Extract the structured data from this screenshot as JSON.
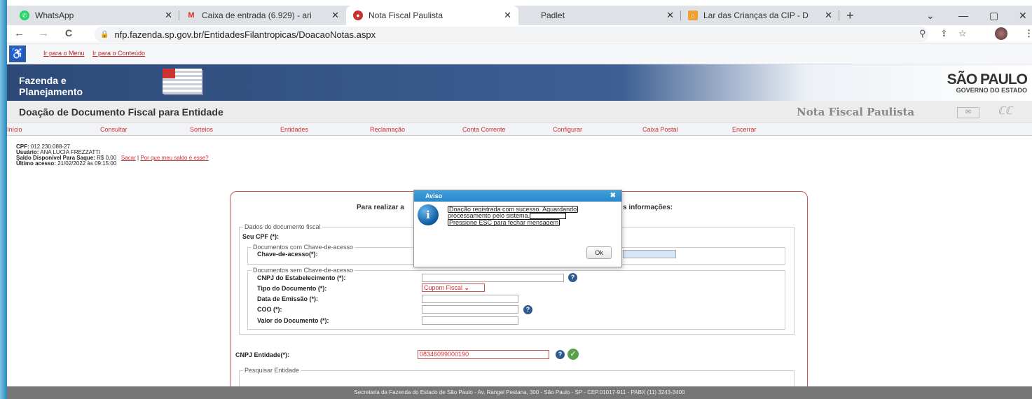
{
  "browser": {
    "tabs": [
      {
        "title": "WhatsApp",
        "active": false
      },
      {
        "title": "Caixa de entrada (6.929) - ari",
        "active": false
      },
      {
        "title": "Nota Fiscal Paulista",
        "active": true
      },
      {
        "title": "Padlet",
        "active": false
      },
      {
        "title": "Lar das Crianças da CIP - Do",
        "active": false
      }
    ],
    "url": "nfp.fazenda.sp.gov.br/EntidadesFilantropicas/DoacaoNotas.aspx",
    "nav": {
      "back": "←",
      "forward": "→",
      "reload": "C",
      "new_tab": "+"
    },
    "window": {
      "dropdown": "⌄",
      "minimize": "—",
      "maximize": "▢",
      "close": "✕"
    }
  },
  "accessibility": {
    "menu_link": "Ir para o Menu",
    "content_link": "Ir para o Conteúdo"
  },
  "banner": {
    "org_line1": "Fazenda e",
    "org_line2": "Planejamento",
    "state_logo_line1": "SÃO PAULO",
    "state_logo_line2": "GOVERNO DO ESTADO"
  },
  "title_bar": {
    "page_title": "Doação de Documento Fiscal para Entidade",
    "brand": "Nota Fiscal Paulista"
  },
  "menu": [
    "Início",
    "Consultar",
    "Sorteios",
    "Entidades",
    "Reclamação",
    "Conta Corrente",
    "Configurar",
    "Caixa Postal",
    "Encerrar"
  ],
  "user": {
    "cpf_label": "CPF:",
    "cpf": "012.230.088-27",
    "user_label": "Usuário:",
    "name": "ANA LUCIA FREZZATTI",
    "balance_label": "Saldo Disponível Para Saque:",
    "balance": "R$ 0,00",
    "withdraw_link": "Sacar",
    "separator": "|",
    "why_link": "Por que meu saldo é esse?",
    "last_access_label": "Último acesso:",
    "last_access": "21/02/2022 às 09:15:00"
  },
  "form": {
    "intro": "Para realizar a",
    "intro_tail": "s informações:",
    "doc_legend": "Dados do documento fiscal",
    "cpf_label": "Seu CPF (*):",
    "key_legend": "Documentos com Chave-de-acesso",
    "key_label": "Chave-de-acesso(*):",
    "nokey_legend": "Documentos sem Chave-de-acesso",
    "cnpj_estab_label": "CNPJ do Estabelecimento (*):",
    "doc_type_label": "Tipo do Documento (*):",
    "doc_type_value": "Cupom Fiscal",
    "emission_label": "Data de Emissão (*):",
    "coo_label": "COO (*):",
    "value_label": "Valor do Documento (*):",
    "entity_label": "CNPJ Entidade(*):",
    "entity_value": "08346099000190",
    "search_legend": "Pesquisar Entidade"
  },
  "modal": {
    "title": "Aviso",
    "close": "✖",
    "info_glyph": "i",
    "line1": "Doação registrada com sucesso. Aguardando",
    "line2": "processamento pelo sistema.",
    "line3": "Pressione ESC para fechar mensagem",
    "ok": "Ok"
  },
  "footer": "Secretaria da Fazenda do Estado de São Paulo - Av. Rangel Pestana, 300 - São Paulo - SP - CEP.01017-911 - PABX (11) 3243-3400"
}
